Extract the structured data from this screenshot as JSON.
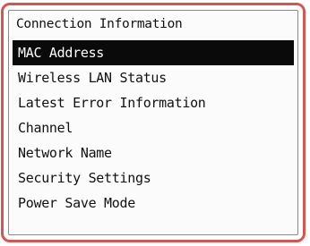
{
  "header": {
    "title": "Connection Information"
  },
  "menu": {
    "selected_index": 0,
    "items": [
      {
        "label": "MAC Address"
      },
      {
        "label": "Wireless LAN Status"
      },
      {
        "label": "Latest Error Information"
      },
      {
        "label": "Channel"
      },
      {
        "label": "Network Name"
      },
      {
        "label": "Security Settings"
      },
      {
        "label": "Power Save Mode"
      }
    ]
  },
  "colors": {
    "frame_border": "#d9544d",
    "selection_background": "#0a0a0a",
    "selection_text": "#ffffff"
  }
}
